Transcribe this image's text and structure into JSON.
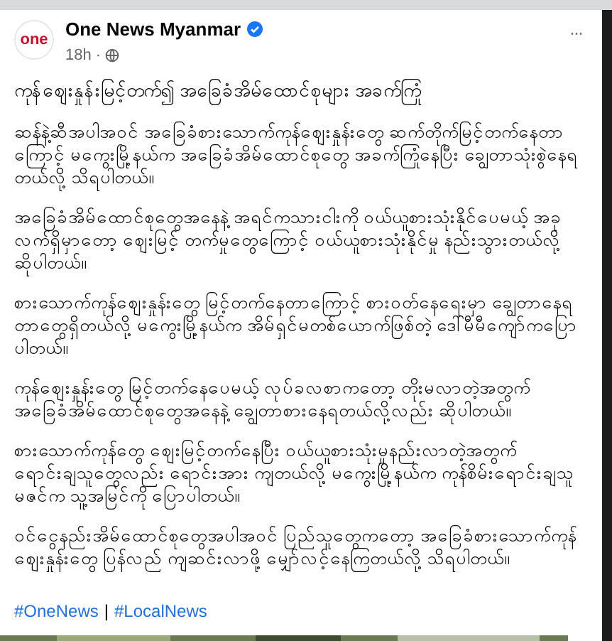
{
  "post": {
    "avatar_text": "one",
    "author": "One News Myanmar",
    "verified": true,
    "time": "18h",
    "separator": "·",
    "more": "···",
    "headline": "ကုန်ဈေးနှုန်းမြင့်တက်၍ အခြေခံအိမ်ထောင်စုများ အခက်ကြုံ",
    "paragraphs": [
      "ဆန်နဲ့ဆီအပါအဝင် အခြေခံစားသောက်ကုန်ဈေးနှုန်းတွေ ဆက်တိုက်မြင့်တက်နေတာကြောင့် မကွေးမြို့နယ်က အခြေခံအိမ်ထောင်စုတွေ အခက်ကြုံနေပြီး ချွေတာသုံးစွဲနေရတယ်လို့ သိရပါတယ်။",
      "အခြေခံအိမ်ထောင်စုတွေအနေနဲ့ အရင်ကသားငါးကို ဝယ်ယူစားသုံးနိုင်ပေမယ့် အခုလက်ရှိမှာတော့ ဈေးမြင့် တက်မှုတွေကြောင့် ဝယ်ယူစားသုံးနိုင်မှု နည်းသွားတယ်လို့ ဆိုပါတယ်။",
      "စားသောက်ကုန်ဈေးနှုန်းတွေ မြင့်တက်နေတာကြောင့် စားဝတ်နေရေးမှာ ချွေတာနေရတာတွေရှိတယ်လို့ မကွေးမြို့နယ်က အိမ်ရှင်မတစ်ယောက်ဖြစ်တဲ့ ဒေါ်မီမီကျော်ကပြောပါတယ်။",
      "ကုန်ဈေးနှုန်းတွေ မြင့်တက်နေပေမယ့် လုပ်ခလစာကတော့ တိုးမလာတဲ့အတွက် အခြေခံအိမ်ထောင်စုတွေအနေနဲ့ ချွေတာစားနေရတယ်လို့လည်း ဆိုပါတယ်။",
      "စားသောက်ကုန်တွေ ဈေးမြင့်တက်နေပြီး ဝယ်ယူစားသုံးမှုနည်းလာတဲ့အတွက် ရောင်းချသူတွေလည်း ရောင်းအား ကျတယ်လို့ မကွေးမြို့နယ်က ကုန်စိမ်းရောင်းချသူ မဇင်က သူ့အမြင်ကို ပြောပါတယ်။",
      "ဝင်ငွေနည်းအိမ်ထောင်စုတွေအပါအဝင် ပြည်သူတွေကတော့ အခြေခံစားသောက်ကုန်ဈေးနှုန်းတွေ ပြန်လည် ကျဆင်းလာဖို့ မျှော်လင့်နေကြတယ်လို့ သိရပါတယ်။"
    ],
    "hashtags": [
      "#OneNews",
      "#LocalNews"
    ],
    "hashtag_separator": "|"
  }
}
